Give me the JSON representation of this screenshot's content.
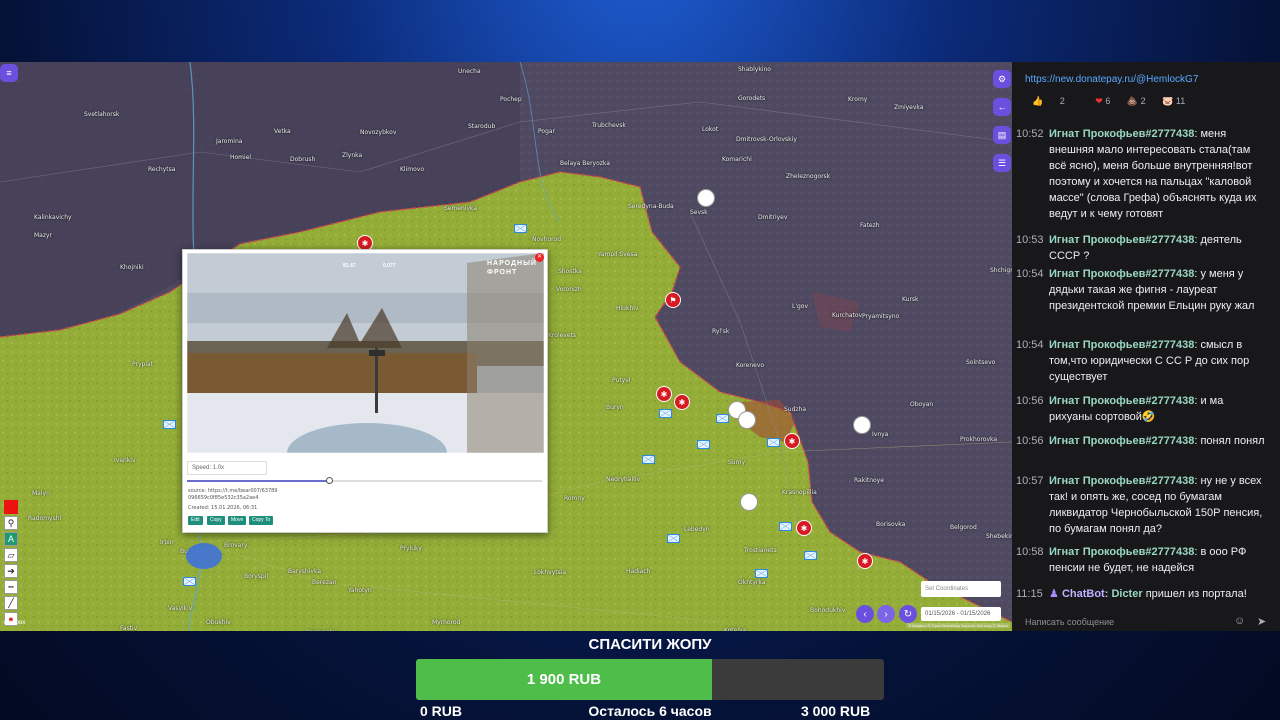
{
  "map": {
    "cities": [
      [
        "Unecha",
        458,
        6
      ],
      [
        "Shablykino",
        738,
        4
      ],
      [
        "Svetlahorsk",
        84,
        49
      ],
      [
        "Pochep",
        500,
        34
      ],
      [
        "Gorodets",
        738,
        33
      ],
      [
        "Kromy",
        848,
        34
      ],
      [
        "Zmiyevka",
        894,
        42
      ],
      [
        "Trubchevsk",
        592,
        60
      ],
      [
        "Lokot",
        702,
        64
      ],
      [
        "Dmitrovsk-Orlovskiy",
        736,
        74
      ],
      [
        "Vetka",
        274,
        66
      ],
      [
        "Novozybkov",
        360,
        67
      ],
      [
        "Starodub",
        468,
        61
      ],
      [
        "Pogar",
        538,
        66
      ],
      [
        "Jaromina",
        216,
        76
      ],
      [
        "Homiel",
        230,
        92
      ],
      [
        "Dobrush",
        290,
        94
      ],
      [
        "Zlynka",
        342,
        90
      ],
      [
        "Komarichi",
        722,
        94
      ],
      [
        "Rechytsa",
        148,
        104
      ],
      [
        "Klimovo",
        400,
        104
      ],
      [
        "Belaya Beryozka",
        560,
        98
      ],
      [
        "Zheleznogorsk",
        786,
        111
      ],
      [
        "Sevsk",
        690,
        147
      ],
      [
        "Dmitriyev",
        758,
        152
      ],
      [
        "Fatezh",
        860,
        160
      ],
      [
        "Semenivka",
        444,
        143
      ],
      [
        "Seredyna-Buda",
        628,
        141
      ],
      [
        "Kalinkavichy",
        34,
        152
      ],
      [
        "Mazyr",
        34,
        170
      ],
      [
        "Novhorod",
        532,
        174
      ],
      [
        "Khojniki",
        120,
        202
      ],
      [
        "Shostka",
        558,
        206
      ],
      [
        "Yampil Svesa",
        598,
        189
      ],
      [
        "Shchigry",
        990,
        205
      ],
      [
        "Voronizh",
        556,
        224
      ],
      [
        "Hlukhiv",
        616,
        243
      ],
      [
        "L'gov",
        792,
        241
      ],
      [
        "Kursk",
        902,
        234
      ],
      [
        "Ryl'sk",
        712,
        266
      ],
      [
        "Kurchatov",
        832,
        250
      ],
      [
        "Pryamitsyno",
        862,
        251
      ],
      [
        "Krolevets",
        548,
        270
      ],
      [
        "Korenevo",
        736,
        300
      ],
      [
        "Solntsevo",
        966,
        297
      ],
      [
        "Prypiat",
        132,
        299
      ],
      [
        "Putyvl",
        612,
        315
      ],
      [
        "Sudzha",
        784,
        344
      ],
      [
        "Oboyan",
        910,
        339
      ],
      [
        "Buryn",
        606,
        342
      ],
      [
        "Ivnya",
        872,
        369
      ],
      [
        "Prokhorovka",
        960,
        374
      ],
      [
        "Ivankiv",
        114,
        395
      ],
      [
        "Sumy",
        728,
        397
      ],
      [
        "Nedryhailiv",
        606,
        414
      ],
      [
        "Rakitnoye",
        854,
        415
      ],
      [
        "Krasnopillia",
        782,
        427
      ],
      [
        "Malyn",
        32,
        428
      ],
      [
        "Romny",
        564,
        433
      ],
      [
        "Borisovka",
        876,
        459
      ],
      [
        "Belgorod",
        950,
        462
      ],
      [
        "Radomyshl",
        28,
        453
      ],
      [
        "Lebedyn",
        684,
        464
      ],
      [
        "Trostianets",
        744,
        485
      ],
      [
        "Shebekino",
        986,
        471
      ],
      [
        "Bucha",
        180,
        486
      ],
      [
        "Irpin",
        160,
        477
      ],
      [
        "Brovary",
        224,
        480
      ],
      [
        "Pryluky",
        400,
        483
      ],
      [
        "Lokhvytsia",
        534,
        507
      ],
      [
        "Hadiach",
        626,
        506
      ],
      [
        "Okhtyrka",
        738,
        517
      ],
      [
        "Boryspil",
        244,
        511
      ],
      [
        "Baryshivka",
        288,
        506
      ],
      [
        "Berezan",
        312,
        517
      ],
      [
        "Yahotyn",
        348,
        525
      ],
      [
        "Vasylkiv",
        168,
        543
      ],
      [
        "Obukhiv",
        206,
        557
      ],
      [
        "Myrhorod",
        432,
        557
      ],
      [
        "Bohodukhiv",
        810,
        545
      ],
      [
        "Fastiv",
        120,
        563
      ],
      [
        "Pereyaslav",
        306,
        567
      ],
      [
        "Kotelva",
        724,
        565
      ]
    ],
    "popup": {
      "speed_label": "Speed: 1.0x",
      "source_line1": "source: https://t.me/bear007/63789",
      "source_line2": "096659c0f85e532c35a2ae4",
      "created": "Created: 15.01.2026, 06:31",
      "buttons": [
        "Edit",
        "Copy",
        "Move",
        "Copy To"
      ],
      "watermark": "НАРОДНЫЙ ФРОНТ",
      "video_hud_left": "81.47",
      "video_hud_right": "0.077",
      "speed_fraction": 0.4
    },
    "coord_placeholder": "Set Coordinates",
    "date_range": "01/15/2026 - 01/15/2026",
    "attribution": "© Mapbox © OpenStreetMap Improve this map © Maxar",
    "logo_text": "mapbox"
  },
  "chat": {
    "link": "https://new.donatepay.ru/@HemlockG7",
    "reactions": [
      [
        "👍",
        "2"
      ],
      [
        "❤",
        "6"
      ],
      [
        "💩",
        "2"
      ],
      [
        "🐷",
        "11"
      ]
    ],
    "messages": [
      {
        "time": "10:52",
        "user": "Игнат Прокофьев#2777438",
        "text": "меня внешняя мало интересовать стала(там всё ясно), меня больше внутренняя!вот поэтому и хочется на пальцах \"каловой массе\" (слова Грефа) объяснять куда их ведут и к чему готовят"
      },
      {
        "time": "10:53",
        "user": "Игнат Прокофьев#2777438",
        "text": "деятель СССР ?"
      },
      {
        "time": "10:54",
        "user": "Игнат Прокофьев#2777438",
        "text": "у меня у дядьки такая же фигня - лауреат президентской премии Ельцин руку жал"
      },
      {
        "time": "10:54",
        "user": "Игнат Прокофьев#2777438",
        "text": "смысл в том,что юридически С СС Р до сих пор существует"
      },
      {
        "time": "10:56",
        "user": "Игнат Прокофьев#2777438",
        "text": "и ма рихуаны сортовой🤣"
      },
      {
        "time": "10:56",
        "user": "Игнат Прокофьев#2777438",
        "text": "понял понял"
      },
      {
        "time": "10:57",
        "user": "Игнат Прокофьев#2777438",
        "text": "ну не у всех так! и опять же, сосед по бумагам ликвидатор Чернобыльской 150Р пенсия, по бумагам понял да?"
      },
      {
        "time": "10:58",
        "user": "Игнат Прокофьев#2777438",
        "text": "в ооо РФ пенсии не будет, не надейся"
      }
    ],
    "bot": {
      "time": "11:15",
      "name": "ChatBot:",
      "user": "Dicter",
      "text": "пришел из портала!"
    },
    "input_placeholder": "Написать сообщение"
  },
  "goal": {
    "title": "СПАСИТИ ЖОПУ",
    "current": "1 900 RUB",
    "min": "0 RUB",
    "remaining": "Осталось 6 часов",
    "target": "3 000 RUB",
    "progress": 0.633
  },
  "colors": {
    "accent": "#6b50e0",
    "ukraine": "#9ab43b",
    "russia": "#4e4a5e",
    "goal_fill": "#4fbd4a",
    "chat_name": "#9ad7c0"
  }
}
